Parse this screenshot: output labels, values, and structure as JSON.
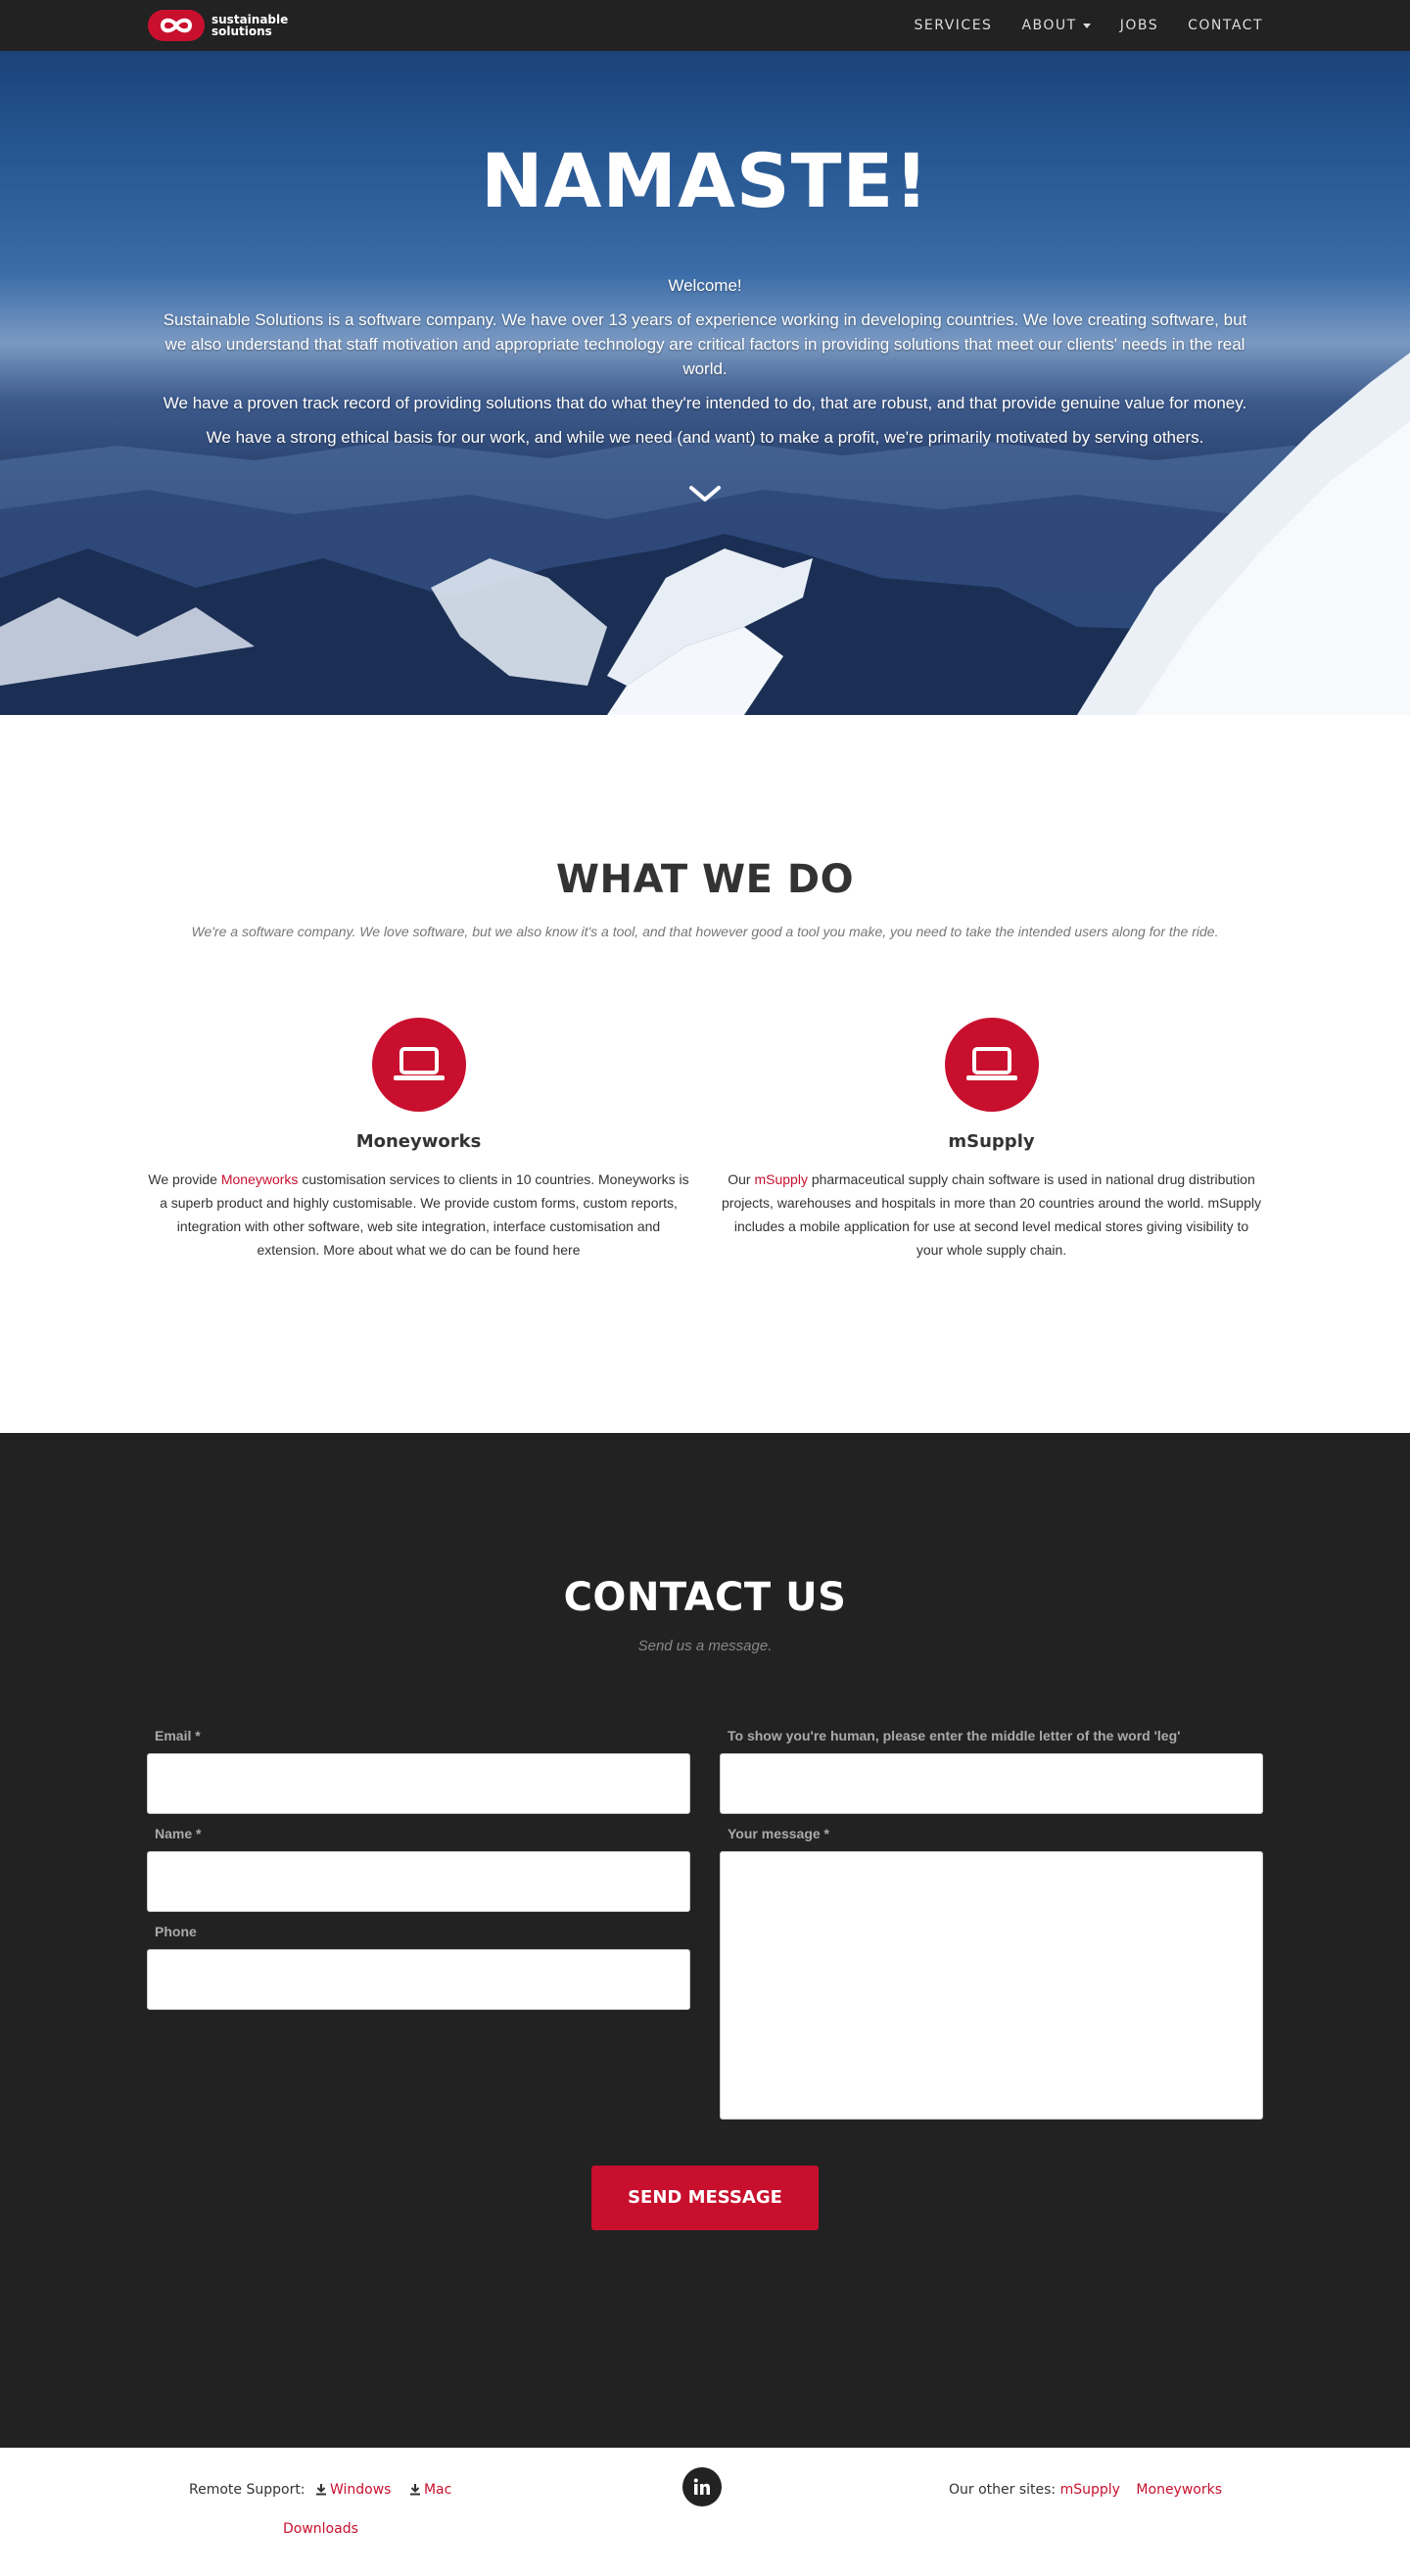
{
  "nav": {
    "brand_line1": "sustainable",
    "brand_line2": "solutions",
    "links": [
      "SERVICES",
      "ABOUT",
      "JOBS",
      "CONTACT"
    ]
  },
  "hero": {
    "title": "NAMASTE!",
    "welcome": "Welcome!",
    "p1": "Sustainable Solutions is a software company. We have over 13 years of experience working in developing countries. We love creating software, but we also understand that staff motivation and appropriate technology are critical factors in providing solutions that meet our clients' needs in the real world.",
    "p2": "We have a proven track record of providing solutions that do what they're intended to do, that are robust, and that provide genuine value for money.",
    "p3": "We have a strong ethical basis for our work, and while we need (and want) to make a profit, we're primarily motivated by serving others."
  },
  "services": {
    "title": "WHAT WE DO",
    "subtitle": "We're a software company. We love software, but we also know it's a tool, and that however good a tool you make, you need to take the intended users along for the ride.",
    "items": [
      {
        "title": "Moneyworks",
        "pre": "We provide ",
        "link": "Moneyworks",
        "post": " customisation services to clients in 10 countries. Moneyworks is a superb product and highly customisable. We provide custom forms, custom reports, integration with other software, web site integration, interface customisation and extension. More about what we do can be found here"
      },
      {
        "title": "mSupply",
        "pre": "Our ",
        "link": "mSupply",
        "post": " pharmaceutical supply chain software is used in national drug distribution projects, warehouses and hospitals in more than 20 countries around the world. mSupply includes a mobile application for use at second level medical stores giving visibility to your whole supply chain."
      }
    ]
  },
  "contact": {
    "title": "CONTACT US",
    "subtitle": "Send us a message.",
    "email_label": "Email *",
    "name_label": "Name *",
    "phone_label": "Phone",
    "human_label": "To show you're human, please enter the middle letter of the word 'leg'",
    "message_label": "Your message *",
    "send_label": "SEND MESSAGE"
  },
  "footer": {
    "remote_support": "Remote Support:",
    "windows": "Windows",
    "mac": "Mac",
    "downloads": "Downloads",
    "other_sites": "Our other sites:",
    "site1": "mSupply",
    "site2": "Moneyworks",
    "social_icon": "linkedin-icon"
  },
  "colors": {
    "accent": "#c8102e",
    "dark": "#222222"
  }
}
